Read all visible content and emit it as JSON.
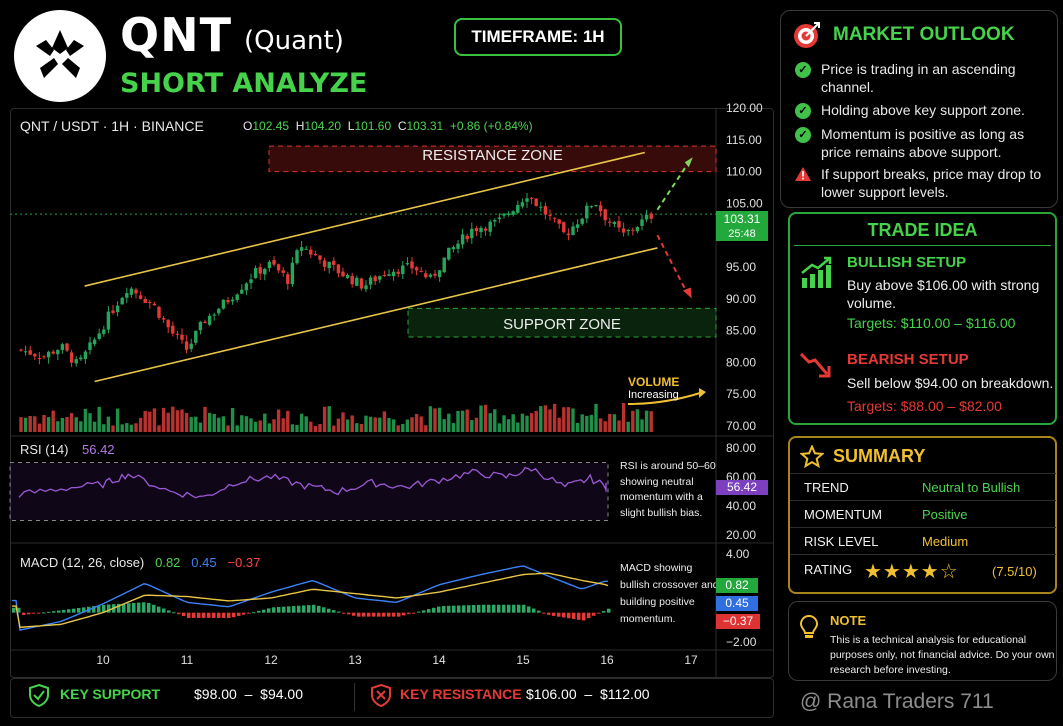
{
  "header": {
    "title": "QNT",
    "title_sub": "(Quant)",
    "subtitle": "SHORT ANALYZE",
    "timeframe": "TIMEFRAME: 1H"
  },
  "chart_info": {
    "symbol_line": "QNT / USDT · 1H · BINANCE",
    "o_label": "O",
    "o_val": "102.45",
    "h_label": "H",
    "h_val": "104.20",
    "l_label": "L",
    "l_val": "101.60",
    "c_label": "C",
    "c_val": "103.31",
    "change": "+0.86 (+0.84%)",
    "price_tag": "103.31",
    "countdown": "25:48",
    "resistance_zone": "RESISTANCE ZONE",
    "support_zone": "SUPPORT ZONE",
    "volume_label": "VOLUME",
    "volume_note": "Increasing"
  },
  "chart_data": [
    {
      "type": "candlestick",
      "title": "QNT / USDT · 1H · BINANCE",
      "x_ticks": [
        "10",
        "11",
        "12",
        "13",
        "14",
        "15",
        "16",
        "17"
      ],
      "y_ticks": [
        "120.00",
        "115.00",
        "110.00",
        "105.00",
        "95.00",
        "90.00",
        "85.00",
        "80.00",
        "75.00",
        "70.00"
      ],
      "ylim": [
        70,
        120
      ],
      "close_path": [
        {
          "x": 9.0,
          "y": 82.0
        },
        {
          "x": 9.3,
          "y": 81.0
        },
        {
          "x": 9.5,
          "y": 82.5
        },
        {
          "x": 9.7,
          "y": 79.5
        },
        {
          "x": 9.9,
          "y": 83.5
        },
        {
          "x": 10.1,
          "y": 88.0
        },
        {
          "x": 10.3,
          "y": 92.0
        },
        {
          "x": 10.6,
          "y": 89.0
        },
        {
          "x": 10.8,
          "y": 85.0
        },
        {
          "x": 11.0,
          "y": 82.0
        },
        {
          "x": 11.2,
          "y": 86.5
        },
        {
          "x": 11.5,
          "y": 90.0
        },
        {
          "x": 11.8,
          "y": 94.0
        },
        {
          "x": 12.0,
          "y": 95.5
        },
        {
          "x": 12.2,
          "y": 93.0
        },
        {
          "x": 12.35,
          "y": 98.5
        },
        {
          "x": 12.6,
          "y": 96.0
        },
        {
          "x": 12.9,
          "y": 93.5
        },
        {
          "x": 13.1,
          "y": 92.0
        },
        {
          "x": 13.4,
          "y": 94.5
        },
        {
          "x": 13.7,
          "y": 95.0
        },
        {
          "x": 13.9,
          "y": 93.0
        },
        {
          "x": 14.1,
          "y": 97.0
        },
        {
          "x": 14.4,
          "y": 101.0
        },
        {
          "x": 14.7,
          "y": 102.0
        },
        {
          "x": 14.9,
          "y": 104.5
        },
        {
          "x": 15.05,
          "y": 106.5
        },
        {
          "x": 15.3,
          "y": 103.0
        },
        {
          "x": 15.5,
          "y": 100.0
        },
        {
          "x": 15.7,
          "y": 103.0
        },
        {
          "x": 15.85,
          "y": 105.5
        },
        {
          "x": 16.0,
          "y": 102.5
        },
        {
          "x": 16.2,
          "y": 100.0
        },
        {
          "x": 16.4,
          "y": 102.0
        },
        {
          "x": 16.55,
          "y": 103.3
        }
      ],
      "overlays": {
        "resistance_zone": [
          110,
          114
        ],
        "support_zone": [
          84,
          88.5
        ],
        "current_price": 103.31,
        "channel_upper": [
          {
            "x": 9.9,
            "y": 92
          },
          {
            "x": 16.45,
            "y": 113
          }
        ],
        "channel_lower": [
          {
            "x": 9.9,
            "y": 77
          },
          {
            "x": 16.6,
            "y": 98
          }
        ],
        "bullish_projection": [
          {
            "x": 16.6,
            "y": 104
          },
          {
            "x": 16.95,
            "y": 111
          }
        ],
        "bearish_projection": [
          {
            "x": 16.6,
            "y": 100
          },
          {
            "x": 16.95,
            "y": 91
          }
        ]
      }
    },
    {
      "type": "line",
      "title": "RSI (14)",
      "value": "56.42",
      "ylim": [
        20,
        80
      ],
      "y_ticks": [
        "80.00",
        "60.00",
        "40.00",
        "20.00"
      ],
      "band": [
        30,
        70
      ],
      "series": [
        {
          "name": "RSI (14)",
          "x": [
            9,
            9.5,
            10,
            10.3,
            10.8,
            11.2,
            11.6,
            12,
            12.4,
            12.8,
            13.2,
            13.6,
            14,
            14.4,
            14.8,
            15.1,
            15.5,
            15.8,
            16.1,
            16.4
          ],
          "values": [
            48,
            52,
            55,
            62,
            50,
            46,
            57,
            60,
            54,
            50,
            56,
            53,
            58,
            63,
            60,
            66,
            53,
            59,
            50,
            56.42
          ]
        }
      ]
    },
    {
      "type": "line",
      "title": "MACD (12, 26, close)",
      "params": [
        "0.82",
        "0.45",
        "−0.37"
      ],
      "ylim": [
        -2,
        4
      ],
      "y_ticks": [
        "4.00",
        "−2.00"
      ],
      "values": {
        "macd": "0.82",
        "signal": "0.45",
        "histogram": "−0.37"
      },
      "series": [
        {
          "name": "MACD",
          "x": [
            9,
            9.5,
            10,
            10.5,
            11,
            11.5,
            12,
            12.5,
            13,
            13.5,
            14,
            14.5,
            15,
            15.3,
            15.7,
            16,
            16.3
          ],
          "values": [
            -1.2,
            -0.6,
            0.6,
            2.0,
            0.7,
            0.4,
            1.4,
            2.2,
            1.0,
            0.7,
            1.9,
            2.6,
            3.2,
            2.5,
            1.6,
            2.2,
            0.82
          ]
        },
        {
          "name": "Signal",
          "x": [
            9,
            9.5,
            10,
            10.5,
            11,
            11.5,
            12,
            12.5,
            13,
            13.5,
            14,
            14.5,
            15,
            15.3,
            15.7,
            16,
            16.3
          ],
          "values": [
            -1.0,
            -0.8,
            0.0,
            1.2,
            1.1,
            0.8,
            1.0,
            1.6,
            1.3,
            1.0,
            1.4,
            2.0,
            2.6,
            2.7,
            2.2,
            1.9,
            0.45
          ]
        }
      ]
    }
  ],
  "rsi_note": "RSI is around 50–60 showing neutral momentum with a slight bullish bias.",
  "macd_note": "MACD showing bullish crossover and building positive momentum.",
  "outlook": {
    "title": "MARKET OUTLOOK",
    "items": [
      {
        "text": "Price is trading in an ascending channel.",
        "icon": "check-icon"
      },
      {
        "text": "Holding above key support zone.",
        "icon": "check-icon"
      },
      {
        "text": "Momentum is positive as long as price remains above support.",
        "icon": "check-icon"
      },
      {
        "text": "If support breaks, price may drop to lower support levels.",
        "icon": "warning-icon"
      }
    ]
  },
  "trade": {
    "title": "TRADE IDEA",
    "bull_title": "BULLISH SETUP",
    "bull_text": "Buy above $106.00 with strong volume.",
    "bull_targets": "Targets: $110.00 – $116.00",
    "bear_title": "BEARISH SETUP",
    "bear_text": "Sell below $94.00 on breakdown.",
    "bear_targets": "Targets: $88.00 – $82.00"
  },
  "summary": {
    "title": "SUMMARY",
    "rows": [
      {
        "label": "TREND",
        "value": "Neutral to Bullish",
        "color": "#4cd44f"
      },
      {
        "label": "MOMENTUM",
        "value": "Positive",
        "color": "#4cd44f"
      },
      {
        "label": "RISK LEVEL",
        "value": "Medium",
        "color": "#f0c030"
      }
    ],
    "rating_label": "RATING",
    "rating_stars": 4,
    "rating_max": 5,
    "rating_text": "(7.5/10)"
  },
  "note": {
    "title": "NOTE",
    "text": "This is a technical analysis for educational purposes only, not financial advice. Do your own research before investing."
  },
  "bottom": {
    "support_label": "KEY SUPPORT",
    "support_range": "$98.00  –  $94.00",
    "resist_label": "KEY RESISTANCE",
    "resist_range": "$106.00  –  $112.00"
  },
  "watermark": "@ Rana Traders 711",
  "colors": {
    "bull": "#26a65b",
    "bear": "#e53935",
    "accent": "#46d24a",
    "gold": "#f0c030",
    "rsi": "#9b59d6",
    "macd": "#3b82f6",
    "signal": "#e8c547"
  }
}
